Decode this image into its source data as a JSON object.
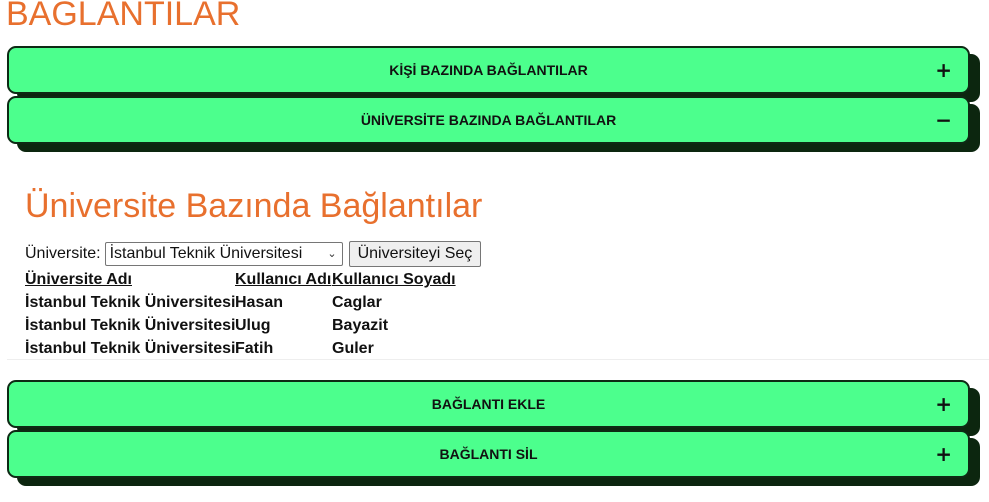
{
  "page": {
    "title": "BAĞLANTILAR"
  },
  "accordions": {
    "person": {
      "label": "KİŞİ BAZINDA BAĞLANTILAR",
      "icon": "+"
    },
    "university": {
      "label": "ÜNİVERSİTE BAZINDA BAĞLANTILAR",
      "icon": "−"
    },
    "add": {
      "label": "BAĞLANTI EKLE",
      "icon": "+"
    },
    "delete": {
      "label": "BAĞLANTI SİL",
      "icon": "+"
    }
  },
  "panel": {
    "title": "Üniversite Bazında Bağlantılar",
    "select_label": "Üniversite:",
    "select_value": "İstanbul Teknik Üniversitesi",
    "button_label": "Üniversiteyi Seç",
    "table": {
      "headers": [
        "Üniversite Adı",
        "Kullanıcı Adı",
        "Kullanıcı Soyadı"
      ],
      "rows": [
        [
          "İstanbul Teknik Üniversitesi",
          "Hasan",
          "Caglar"
        ],
        [
          "İstanbul Teknik Üniversitesi",
          "Ulug",
          "Bayazit"
        ],
        [
          "İstanbul Teknik Üniversitesi",
          "Fatih",
          "Guler"
        ]
      ]
    }
  },
  "colors": {
    "accent": "#e8702e",
    "accordion_bg": "#4cff8d",
    "shadow": "#0c260f"
  },
  "icons": {
    "collapsed": "plus-icon",
    "expanded": "minus-icon",
    "select": "chevron-down-icon"
  }
}
